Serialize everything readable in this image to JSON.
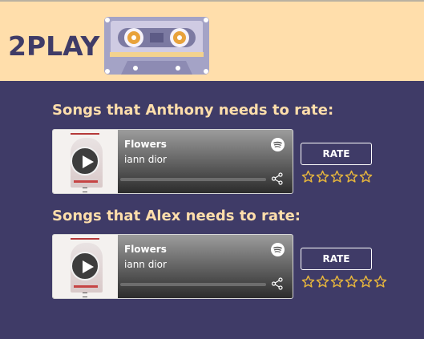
{
  "app": {
    "brand": "2PLAY"
  },
  "sections": [
    {
      "title": "Songs that Anthony needs to rate:",
      "track": {
        "title": "Flowers",
        "artist": "iann dior",
        "progress": 0
      },
      "rate_label": "RATE",
      "rating": {
        "value": 0,
        "max": 5
      }
    },
    {
      "title": "Songs that Alex needs to rate:",
      "track": {
        "title": "Flowers",
        "artist": "iann dior",
        "progress": 0
      },
      "rate_label": "RATE",
      "rating": {
        "value": 0,
        "max": 5
      }
    }
  ],
  "icons": {
    "cassette": "cassette-icon",
    "play": "play-icon",
    "spotify": "spotify-icon",
    "share": "share-icon",
    "star": "star-outline-icon"
  },
  "colors": {
    "background": "#3f3b67",
    "header": "#ffdeab",
    "star": "#e7b63c"
  }
}
